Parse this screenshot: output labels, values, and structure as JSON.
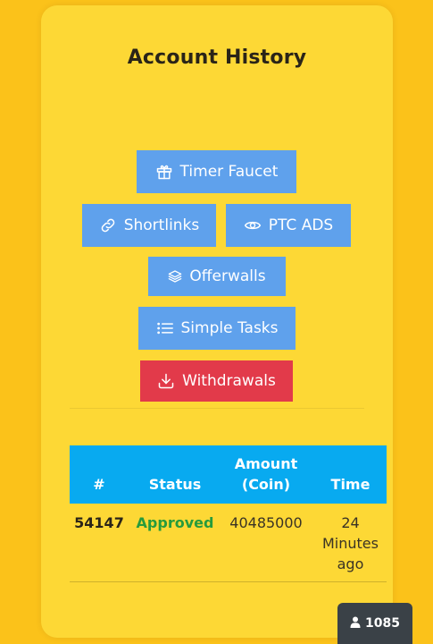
{
  "page": {
    "title": "Account History"
  },
  "nav": {
    "timer_faucet": "Timer Faucet",
    "shortlinks": "Shortlinks",
    "ptc_ads": "PTC ADS",
    "offerwalls": "Offerwalls",
    "simple_tasks": "Simple Tasks",
    "withdrawals": "Withdrawals"
  },
  "icons": {
    "timer_faucet": "gift-icon",
    "shortlinks": "link-icon",
    "ptc_ads": "eye-icon",
    "offerwalls": "layers-icon",
    "simple_tasks": "list-icon",
    "withdrawals": "download-icon",
    "online": "user-icon"
  },
  "table": {
    "headers": {
      "id": "#",
      "status": "Status",
      "amount_line1": "Amount",
      "amount_line2": "(Coin)",
      "time": "Time"
    },
    "rows": [
      {
        "id": "54147",
        "status": "Approved",
        "amount": "40485000",
        "time_line1": "24",
        "time_line2": "Minutes",
        "time_line3": "ago"
      }
    ]
  },
  "online_users": {
    "count": "1085"
  },
  "colors": {
    "background": "#fbc21a",
    "card": "#fdd835",
    "button_blue": "#5fa1ec",
    "button_red": "#e23a4a",
    "table_header": "#08aaf0",
    "approved": "#279b3c",
    "badge": "#3a4147"
  }
}
